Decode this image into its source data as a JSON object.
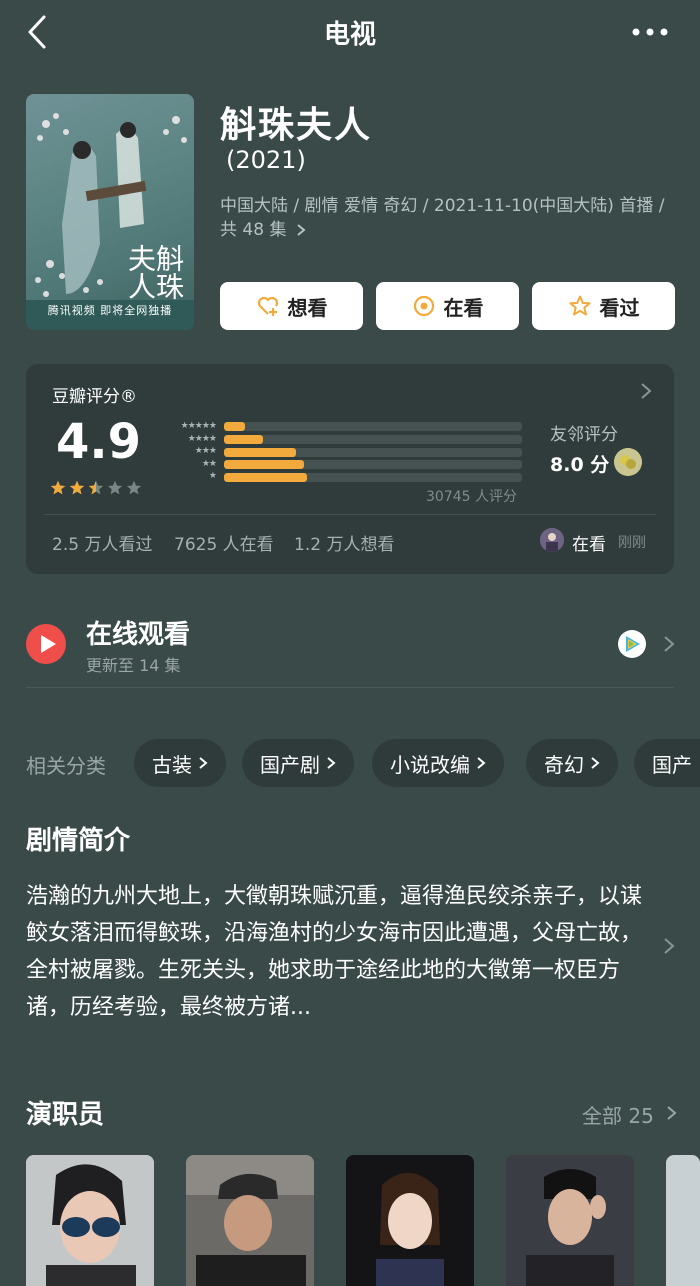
{
  "header": {
    "title": "电视"
  },
  "show": {
    "poster_caption": "腾讯视频 即将全网独播",
    "poster_seal": "斛珠夫人",
    "title": "斛珠夫人",
    "year": "(2021)",
    "meta": "中国大陆 / 剧情 爱情 奇幻 / 2021-11-10(中国大陆) 首播 / 共 48 集"
  },
  "actions": {
    "want_label": "想看",
    "watching_label": "在看",
    "watched_label": "看过"
  },
  "rating": {
    "label": "豆瓣评分®",
    "score": "4.9",
    "stars": 2.5,
    "distribution_star_rows": [
      "★★★★★",
      "★★★★",
      "★★★",
      "★★",
      "★"
    ],
    "distribution_fractions": [
      0.07,
      0.13,
      0.24,
      0.27,
      0.28
    ],
    "count": "30745 人评分",
    "friend_label": "友邻评分",
    "friend_score": "8.0 分",
    "stat_watched": "2.5 万人看过",
    "stat_watching": "7625 人在看",
    "stat_want": "1.2 万人想看",
    "watching_label": "在看",
    "watching_time": "刚刚",
    "accent": "#f2aa3c"
  },
  "online": {
    "title": "在线观看",
    "sub": "更新至 14 集"
  },
  "categories": {
    "label": "相关分类",
    "items": [
      "古装",
      "国产剧",
      "小说改编",
      "奇幻",
      "国产"
    ]
  },
  "synopsis": {
    "title": "剧情简介",
    "text": "浩瀚的九州大地上，大徵朝珠赋沉重，逼得渔民绞杀亲子，以谋鲛女落泪而得鲛珠，沿海渔村的少女海市因此遭遇，父母亡故，全村被屠戮。生死关头，她求助于途经此地的大徵第一权臣方诸，历经考验，最终被方诸..."
  },
  "cast": {
    "title": "演职员",
    "all_label": "全部 25"
  }
}
